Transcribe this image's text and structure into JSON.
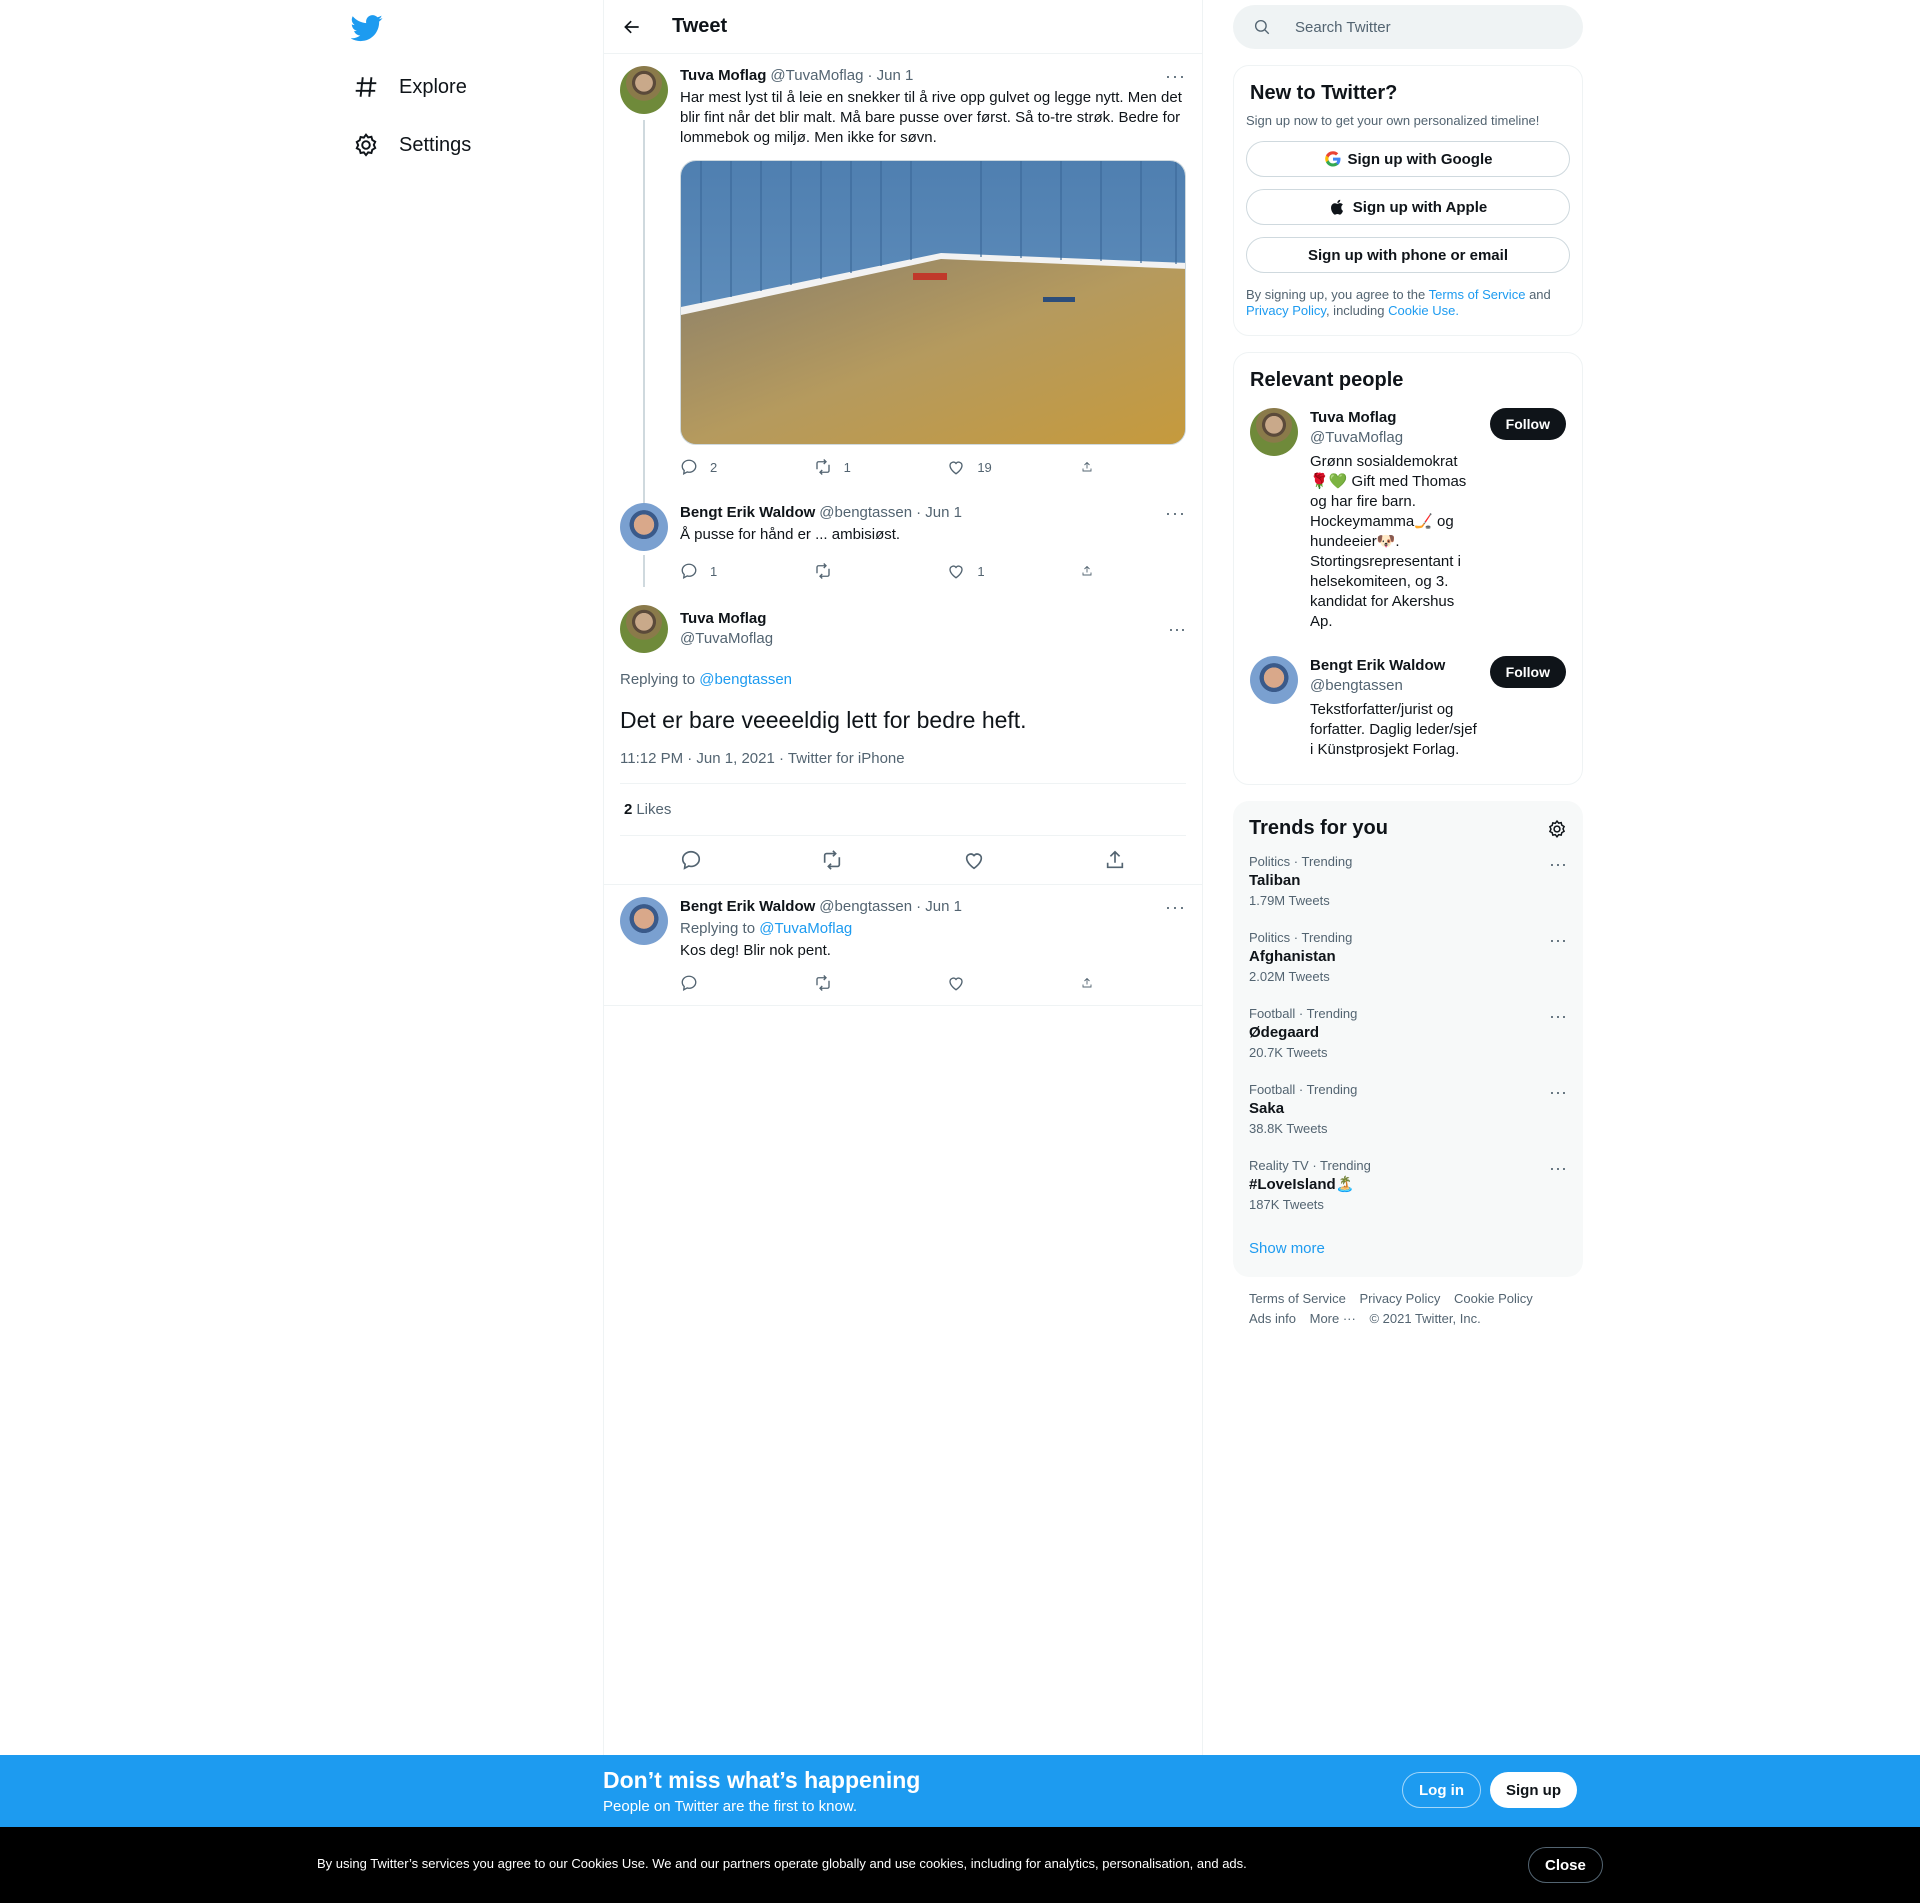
{
  "nav": {
    "explore": "Explore",
    "settings": "Settings"
  },
  "header": {
    "title": "Tweet"
  },
  "thread": [
    {
      "name": "Tuva Moflag",
      "handle": "@TuvaMoflag",
      "date": "· Jun 1",
      "text": "Har mest lyst til å leie en snekker til å rive opp gulvet og legge nytt. Men det blir fint når det blir malt. Må bare pusse over først. Så to-tre strøk. Bedre for lommebok og miljø. Men ikke for søvn.",
      "replies": "2",
      "retweets": "1",
      "likes": "19"
    },
    {
      "name": "Bengt Erik Waldow",
      "handle": "@bengtassen",
      "date": "· Jun 1",
      "text": "Å pusse for hånd er ... ambisiøst.",
      "replies": "1",
      "retweets": "",
      "likes": "1"
    }
  ],
  "focused": {
    "name": "Tuva Moflag",
    "handle": "@TuvaMoflag",
    "replying_label": "Replying to",
    "replying_to": "@bengtassen",
    "text": "Det er bare veeeeldig lett for bedre heft.",
    "timestamp": "11:12 PM · Jun 1, 2021 · Twitter for iPhone",
    "likes_count": "2",
    "likes_label": "Likes"
  },
  "reply": {
    "name": "Bengt Erik Waldow",
    "handle": "@bengtassen",
    "date": "· Jun 1",
    "replying_label": "Replying to",
    "replying_to": "@TuvaMoflag",
    "text": "Kos deg! Blir nok pent."
  },
  "search": {
    "placeholder": "Search Twitter"
  },
  "new_to_twitter": {
    "title": "New to Twitter?",
    "subtitle": "Sign up now to get your own personalized timeline!",
    "google": "Sign up with Google",
    "apple": "Sign up with Apple",
    "phone": "Sign up with phone or email",
    "legal_1": "By signing up, you agree to the",
    "tos": "Terms of Service",
    "legal_2": "and",
    "privacy": "Privacy Policy",
    "legal_3": ", including",
    "cookie": "Cookie Use."
  },
  "relevant": {
    "title": "Relevant people",
    "people": [
      {
        "name": "Tuva Moflag",
        "handle": "@TuvaMoflag",
        "bio": "Grønn sosialdemokrat 🌹💚 Gift med Thomas og har fire barn. Hockeymamma🏒 og hundeeier🐶. Stortingsrepresentant i helsekomiteen, og 3. kandidat for Akershus Ap.",
        "follow": "Follow"
      },
      {
        "name": "Bengt Erik Waldow",
        "handle": "@bengtassen",
        "bio": "Tekstforfatter/jurist og forfatter. Daglig leder/sjef i Künstprosjekt Forlag.",
        "follow": "Follow"
      }
    ]
  },
  "trends": {
    "title": "Trends for you",
    "items": [
      {
        "category": "Politics · Trending",
        "name": "Taliban",
        "count": "1.79M Tweets"
      },
      {
        "category": "Politics · Trending",
        "name": "Afghanistan",
        "count": "2.02M Tweets"
      },
      {
        "category": "Football · Trending",
        "name": "Ødegaard",
        "count": "20.7K Tweets"
      },
      {
        "category": "Football · Trending",
        "name": "Saka",
        "count": "38.8K Tweets"
      },
      {
        "category": "Reality TV · Trending",
        "name": "#LoveIsland🏝️",
        "count": "187K Tweets"
      }
    ],
    "show_more": "Show more"
  },
  "footer": {
    "tos": "Terms of Service",
    "privacy": "Privacy Policy",
    "cookie": "Cookie Policy",
    "ads": "Ads info",
    "more": "More ···",
    "copyright": "© 2021 Twitter, Inc."
  },
  "banner": {
    "title": "Don’t miss what’s happening",
    "subtitle": "People on Twitter are the first to know.",
    "login": "Log in",
    "signup": "Sign up"
  },
  "cookie_bar": {
    "text": "By using Twitter’s services you agree to our Cookies Use. We and our partners operate globally and use cookies, including for analytics, personalisation, and ads.",
    "close": "Close"
  },
  "colors": {
    "accent": "#1d9bf0",
    "text": "#0f1419",
    "muted": "#536471"
  }
}
